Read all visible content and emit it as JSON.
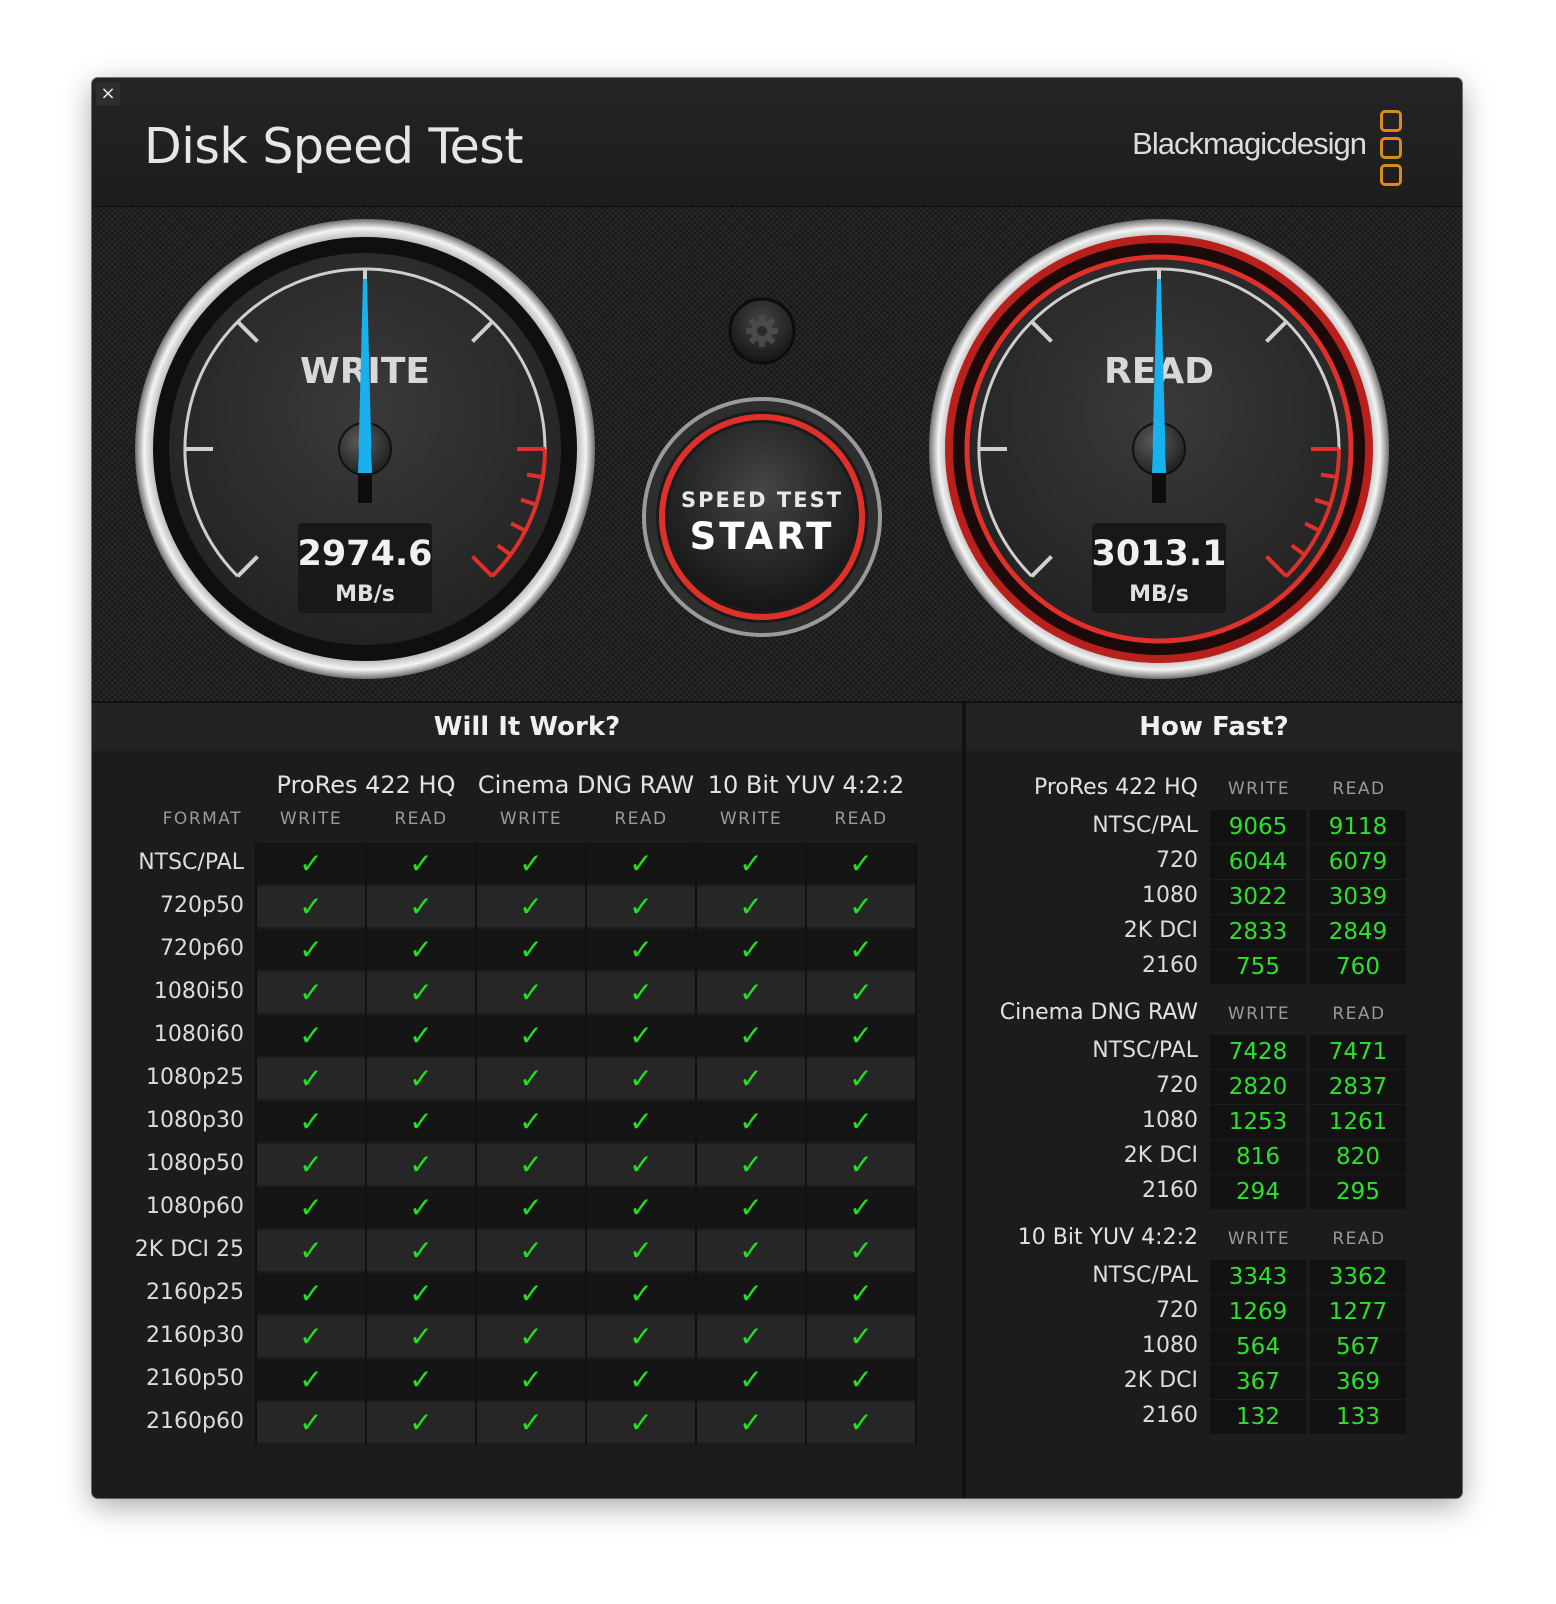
{
  "window": {
    "close_glyph": "×",
    "title": "Disk Speed Test",
    "brand": "Blackmagicdesign"
  },
  "gauges": {
    "write": {
      "label": "WRITE",
      "value": "2974.6",
      "unit": "MB/s",
      "needle_fraction": 0.5
    },
    "read": {
      "label": "READ",
      "value": "3013.1",
      "unit": "MB/s",
      "needle_fraction": 0.5
    }
  },
  "start_button": {
    "line1": "SPEED TEST",
    "line2": "START"
  },
  "settings_icon": "gear-icon",
  "colors": {
    "accent_red": "#e0302a",
    "needle_blue": "#1ab0ec",
    "check_green": "#22e022",
    "brand_orange": "#d98a22"
  },
  "will_it_work": {
    "title": "Will It Work?",
    "format_label": "FORMAT",
    "codecs": [
      "ProRes 422 HQ",
      "Cinema DNG RAW",
      "10 Bit YUV 4:2:2"
    ],
    "sub_labels": [
      "WRITE",
      "READ"
    ],
    "check_glyph": "✓",
    "rows": [
      "NTSC/PAL",
      "720p50",
      "720p60",
      "1080i50",
      "1080i60",
      "1080p25",
      "1080p30",
      "1080p50",
      "1080p60",
      "2K DCI 25",
      "2160p25",
      "2160p30",
      "2160p50",
      "2160p60"
    ]
  },
  "how_fast": {
    "title": "How Fast?",
    "write_label": "WRITE",
    "read_label": "READ",
    "groups": [
      {
        "codec": "ProRes 422 HQ",
        "rows": [
          {
            "label": "NTSC/PAL",
            "write": "9065",
            "read": "9118"
          },
          {
            "label": "720",
            "write": "6044",
            "read": "6079"
          },
          {
            "label": "1080",
            "write": "3022",
            "read": "3039"
          },
          {
            "label": "2K DCI",
            "write": "2833",
            "read": "2849"
          },
          {
            "label": "2160",
            "write": "755",
            "read": "760"
          }
        ]
      },
      {
        "codec": "Cinema DNG RAW",
        "rows": [
          {
            "label": "NTSC/PAL",
            "write": "7428",
            "read": "7471"
          },
          {
            "label": "720",
            "write": "2820",
            "read": "2837"
          },
          {
            "label": "1080",
            "write": "1253",
            "read": "1261"
          },
          {
            "label": "2K DCI",
            "write": "816",
            "read": "820"
          },
          {
            "label": "2160",
            "write": "294",
            "read": "295"
          }
        ]
      },
      {
        "codec": "10 Bit YUV 4:2:2",
        "rows": [
          {
            "label": "NTSC/PAL",
            "write": "3343",
            "read": "3362"
          },
          {
            "label": "720",
            "write": "1269",
            "read": "1277"
          },
          {
            "label": "1080",
            "write": "564",
            "read": "567"
          },
          {
            "label": "2K DCI",
            "write": "367",
            "read": "369"
          },
          {
            "label": "2160",
            "write": "132",
            "read": "133"
          }
        ]
      }
    ]
  }
}
